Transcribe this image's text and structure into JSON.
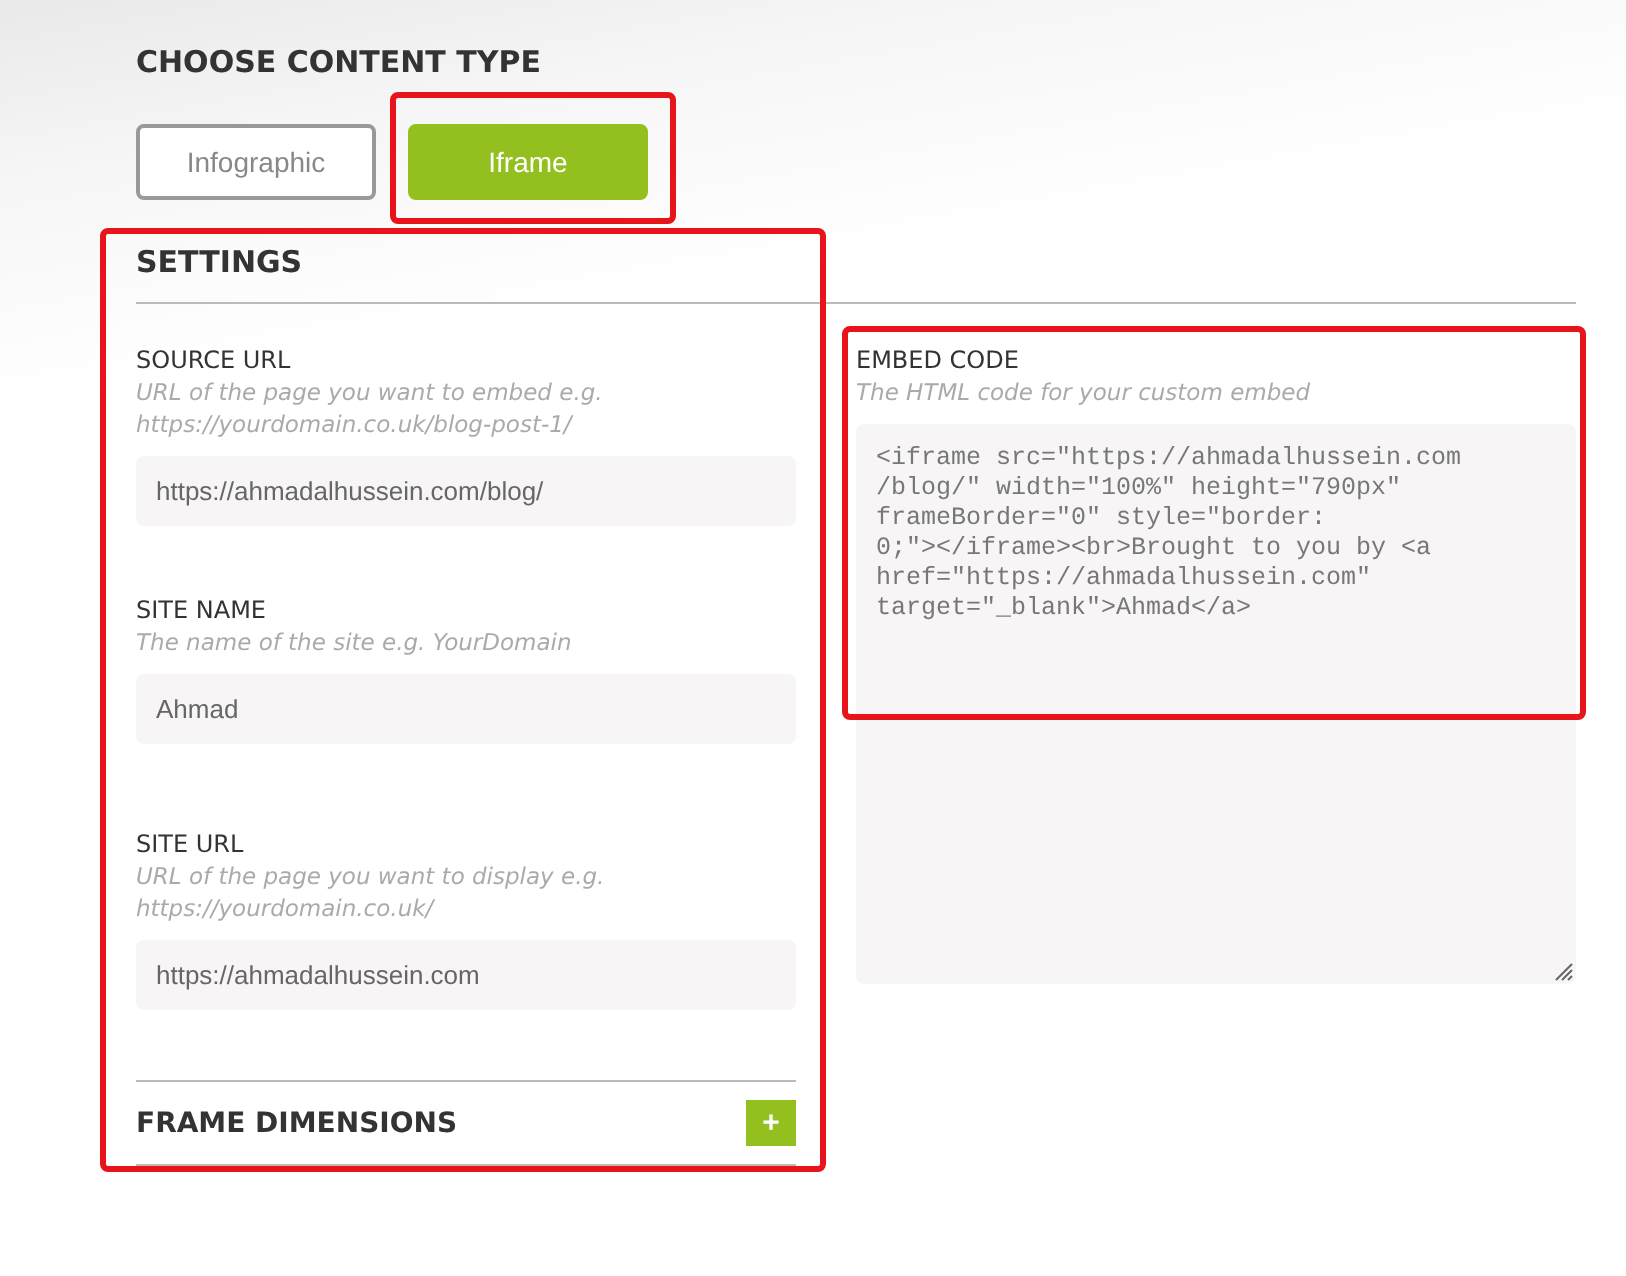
{
  "content_type": {
    "title": "CHOOSE CONTENT TYPE",
    "options": [
      {
        "label": "Infographic",
        "selected": false,
        "highlighted": false
      },
      {
        "label": "Iframe",
        "selected": true,
        "highlighted": true
      }
    ]
  },
  "settings": {
    "title": "SETTINGS",
    "highlighted": true,
    "fields": [
      {
        "label": "SOURCE URL",
        "help": "URL of the page you want to embed e.g. https://yourdomain.co.uk/blog-post-1/",
        "value": "https://ahmadalhussein.com/blog/"
      },
      {
        "label": "SITE NAME",
        "help": "The name of the site e.g. YourDomain",
        "value": "Ahmad"
      },
      {
        "label": "SITE URL",
        "help": "URL of the page you want to display e.g. https://yourdomain.co.uk/",
        "value": "https://ahmadalhussein.com"
      }
    ],
    "section": {
      "title": "FRAME DIMENSIONS",
      "expand_button": "+"
    }
  },
  "embed": {
    "label": "EMBED CODE",
    "help": "The HTML code for your custom embed",
    "highlighted": true,
    "code_lines": [
      "<iframe src=\"https://ahmadalhussein.com",
      "/blog/\" width=\"100%\" height=\"790px\"",
      "frameBorder=\"0\" style=\"border:",
      "0;\"></iframe><br>Brought to you by <a",
      "href=\"https://ahmadalhussein.com\"",
      "target=\"_blank\">Ahmad</a>"
    ]
  }
}
